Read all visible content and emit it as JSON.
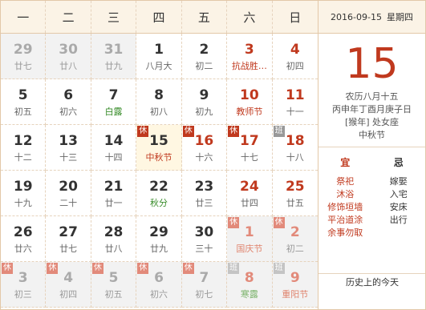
{
  "weekdays": [
    "一",
    "二",
    "三",
    "四",
    "五",
    "六",
    "日"
  ],
  "days": [
    {
      "d": "29",
      "l": "廿七",
      "other": true
    },
    {
      "d": "30",
      "l": "廿八",
      "other": true
    },
    {
      "d": "31",
      "l": "廿九",
      "other": true
    },
    {
      "d": "1",
      "l": "八月大"
    },
    {
      "d": "2",
      "l": "初二"
    },
    {
      "d": "3",
      "l": "抗战胜…",
      "weekend": true,
      "festival": true
    },
    {
      "d": "4",
      "l": "初四",
      "weekend": true
    },
    {
      "d": "5",
      "l": "初五"
    },
    {
      "d": "6",
      "l": "初六"
    },
    {
      "d": "7",
      "l": "白露",
      "term": true
    },
    {
      "d": "8",
      "l": "初八"
    },
    {
      "d": "9",
      "l": "初九"
    },
    {
      "d": "10",
      "l": "教师节",
      "weekend": true,
      "festival": true
    },
    {
      "d": "11",
      "l": "十一",
      "weekend": true
    },
    {
      "d": "12",
      "l": "十二"
    },
    {
      "d": "13",
      "l": "十三"
    },
    {
      "d": "14",
      "l": "十四"
    },
    {
      "d": "15",
      "l": "中秋节",
      "today": true,
      "festival": true,
      "badge": "休",
      "badgeType": "rest"
    },
    {
      "d": "16",
      "l": "十六",
      "badge": "休",
      "badgeType": "rest",
      "red": true
    },
    {
      "d": "17",
      "l": "十七",
      "weekend": true,
      "badge": "休",
      "badgeType": "rest"
    },
    {
      "d": "18",
      "l": "十八",
      "weekend": true,
      "badge": "班",
      "badgeType": "work"
    },
    {
      "d": "19",
      "l": "十九"
    },
    {
      "d": "20",
      "l": "二十"
    },
    {
      "d": "21",
      "l": "廿一"
    },
    {
      "d": "22",
      "l": "秋分",
      "term": true
    },
    {
      "d": "23",
      "l": "廿三"
    },
    {
      "d": "24",
      "l": "廿四",
      "weekend": true
    },
    {
      "d": "25",
      "l": "廿五",
      "weekend": true
    },
    {
      "d": "26",
      "l": "廿六"
    },
    {
      "d": "27",
      "l": "廿七"
    },
    {
      "d": "28",
      "l": "廿八"
    },
    {
      "d": "29",
      "l": "廿九"
    },
    {
      "d": "30",
      "l": "三十"
    },
    {
      "d": "1",
      "l": "国庆节",
      "other": true,
      "weekend": true,
      "festival": true,
      "badge": "休",
      "badgeType": "rest"
    },
    {
      "d": "2",
      "l": "初二",
      "other": true,
      "weekend": true,
      "badge": "休",
      "badgeType": "rest"
    },
    {
      "d": "3",
      "l": "初三",
      "other": true,
      "badge": "休",
      "badgeType": "rest"
    },
    {
      "d": "4",
      "l": "初四",
      "other": true,
      "badge": "休",
      "badgeType": "rest"
    },
    {
      "d": "5",
      "l": "初五",
      "other": true,
      "badge": "休",
      "badgeType": "rest"
    },
    {
      "d": "6",
      "l": "初六",
      "other": true,
      "badge": "休",
      "badgeType": "rest"
    },
    {
      "d": "7",
      "l": "初七",
      "other": true,
      "badge": "休",
      "badgeType": "rest"
    },
    {
      "d": "8",
      "l": "寒露",
      "other": true,
      "weekend": true,
      "term": true,
      "badge": "班",
      "badgeType": "work"
    },
    {
      "d": "9",
      "l": "重阳节",
      "other": true,
      "weekend": true,
      "festival": true,
      "badge": "班",
      "badgeType": "work"
    }
  ],
  "side": {
    "date": "2016-09-15",
    "weekday": "星期四",
    "big_day": "15",
    "lunar": "农历八月十五",
    "ganzhi": "丙申年丁酉月庚子日",
    "zodiac": "[猴年] 处女座",
    "festival": "中秋节",
    "yi_label": "宜",
    "ji_label": "忌",
    "yi": [
      "祭祀",
      "沐浴",
      "修饰垣墙",
      "平治道涂",
      "余事勿取"
    ],
    "ji": [
      "嫁娶",
      "入宅",
      "安床",
      "出行"
    ],
    "history": "历史上的今天"
  },
  "colors": {
    "accent": "#c0391e",
    "term": "#3a8d2c",
    "header_bg": "#fbf3e6"
  }
}
